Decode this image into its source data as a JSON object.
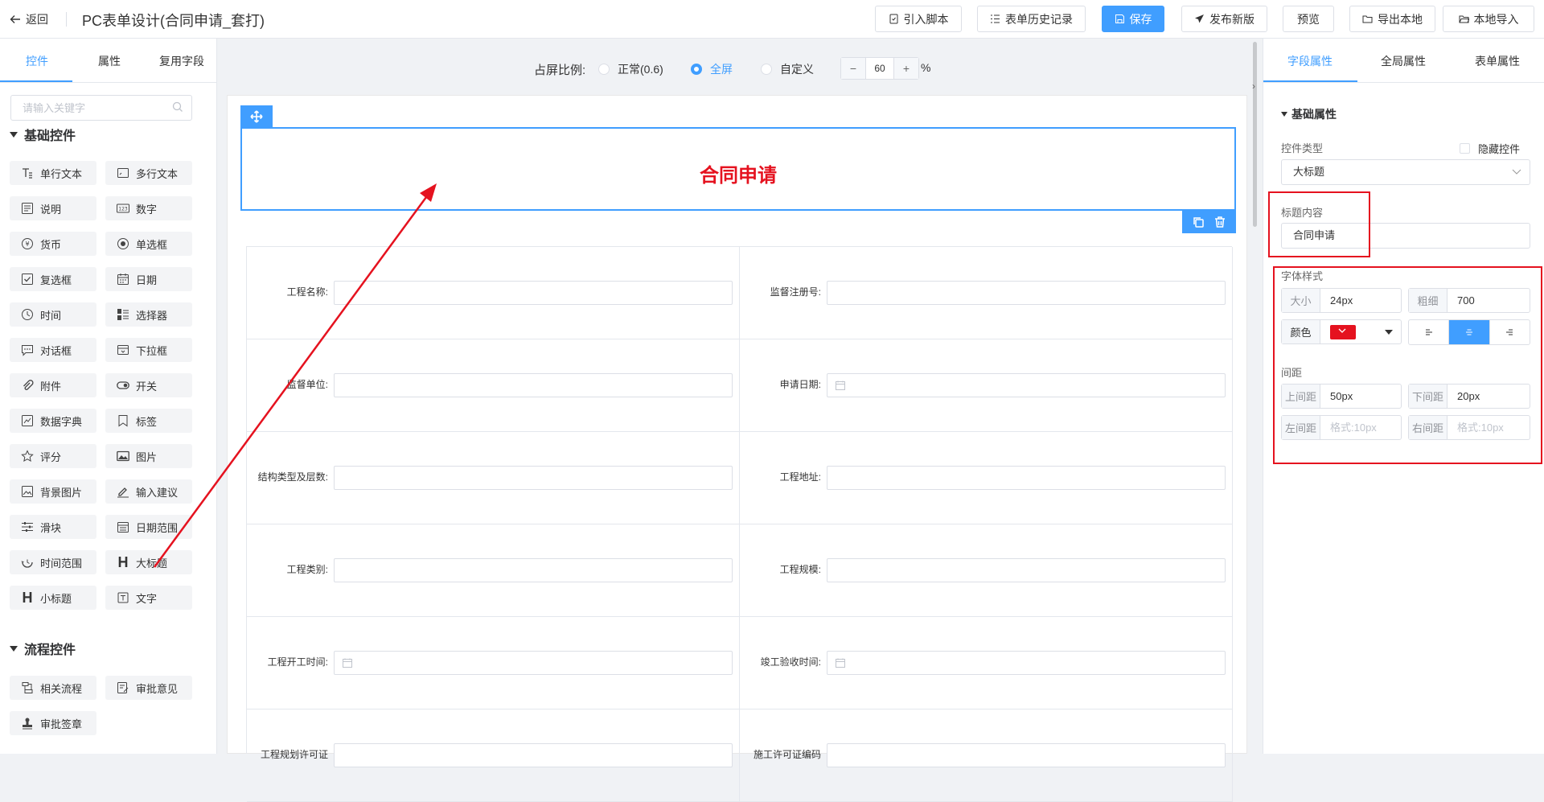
{
  "header": {
    "back_label": "返回",
    "title": "PC表单设计(合同申请_套打)",
    "buttons": {
      "import_script": "引入脚本",
      "form_history": "表单历史记录",
      "save": "保存",
      "publish": "发布新版",
      "preview": "预览",
      "export_local": "导出本地",
      "import_local": "本地导入"
    },
    "primary_color": "#409eff"
  },
  "left_panel": {
    "tabs": [
      "控件",
      "属性",
      "复用字段"
    ],
    "active_tab": "控件",
    "search_placeholder": "请输入关键字",
    "basic_section": "基础控件",
    "basic_controls": [
      {
        "label": "单行文本",
        "icon": "single-line-text-icon"
      },
      {
        "label": "多行文本",
        "icon": "multi-line-text-icon"
      },
      {
        "label": "说明",
        "icon": "description-icon"
      },
      {
        "label": "数字",
        "icon": "number-icon"
      },
      {
        "label": "货币",
        "icon": "currency-icon"
      },
      {
        "label": "单选框",
        "icon": "radio-icon"
      },
      {
        "label": "复选框",
        "icon": "checkbox-icon"
      },
      {
        "label": "日期",
        "icon": "calendar-icon"
      },
      {
        "label": "时间",
        "icon": "clock-icon"
      },
      {
        "label": "选择器",
        "icon": "selector-icon"
      },
      {
        "label": "对话框",
        "icon": "dialog-icon"
      },
      {
        "label": "下拉框",
        "icon": "dropdown-icon"
      },
      {
        "label": "附件",
        "icon": "paperclip-icon"
      },
      {
        "label": "开关",
        "icon": "toggle-icon"
      },
      {
        "label": "数据字典",
        "icon": "data-dictionary-icon"
      },
      {
        "label": "标签",
        "icon": "tag-icon"
      },
      {
        "label": "评分",
        "icon": "star-icon"
      },
      {
        "label": "图片",
        "icon": "image-icon"
      },
      {
        "label": "背景图片",
        "icon": "background-image-icon"
      },
      {
        "label": "输入建议",
        "icon": "input-suggest-icon"
      },
      {
        "label": "滑块",
        "icon": "slider-icon"
      },
      {
        "label": "日期范围",
        "icon": "date-range-icon"
      },
      {
        "label": "时间范围",
        "icon": "time-range-icon"
      },
      {
        "label": "大标题",
        "icon": "heading-large-icon"
      },
      {
        "label": "小标题",
        "icon": "heading-small-icon"
      },
      {
        "label": "文字",
        "icon": "text-icon"
      }
    ],
    "flow_section": "流程控件",
    "flow_controls": [
      {
        "label": "相关流程",
        "icon": "related-flow-icon"
      },
      {
        "label": "审批意见",
        "icon": "approval-opinion-icon"
      },
      {
        "label": "审批签章",
        "icon": "approval-stamp-icon"
      }
    ]
  },
  "canvas": {
    "ratio_label": "占屏比例:",
    "ratio_options": [
      "正常(0.6)",
      "全屏",
      "自定义"
    ],
    "ratio_selected": "全屏",
    "custom_value": "60",
    "stepper_minus": "−",
    "stepper_plus": "+",
    "percent": "%",
    "heading_text": "合同申请",
    "heading_color": "#e5121f",
    "fields": [
      {
        "label": "工程名称:",
        "type": "text"
      },
      {
        "label": "监督注册号:",
        "type": "text"
      },
      {
        "label": "监督单位:",
        "type": "text"
      },
      {
        "label": "申请日期:",
        "type": "date"
      },
      {
        "label": "结构类型及层数:",
        "type": "text"
      },
      {
        "label": "工程地址:",
        "type": "text"
      },
      {
        "label": "工程类别:",
        "type": "text"
      },
      {
        "label": "工程规模:",
        "type": "text"
      },
      {
        "label": "工程开工时间:",
        "type": "date"
      },
      {
        "label": "竣工验收时间:",
        "type": "date"
      },
      {
        "label": "工程规划许可证",
        "type": "text"
      },
      {
        "label": "施工许可证编码",
        "type": "text"
      }
    ]
  },
  "right_panel": {
    "tabs": [
      "字段属性",
      "全局属性",
      "表单属性"
    ],
    "active_tab": "字段属性",
    "section": "基础属性",
    "control_type_label": "控件类型",
    "hide_control_label": "隐藏控件",
    "control_type_value": "大标题",
    "title_content_label": "标题内容",
    "title_content_value": "合同申请",
    "font_style_label": "字体样式",
    "size_label": "大小",
    "size_value": "24px",
    "weight_label": "粗细",
    "weight_value": "700",
    "color_label": "颜色",
    "color_value": "#e5121f",
    "align_selected": "center",
    "spacing_label": "间距",
    "top_margin_label": "上间距",
    "top_margin_value": "50px",
    "bottom_margin_label": "下间距",
    "bottom_margin_value": "20px",
    "left_margin_label": "左间距",
    "left_margin_placeholder": "格式:10px",
    "right_margin_label": "右间距",
    "right_margin_placeholder": "格式:10px",
    "highlight_color": "#e5121f"
  }
}
